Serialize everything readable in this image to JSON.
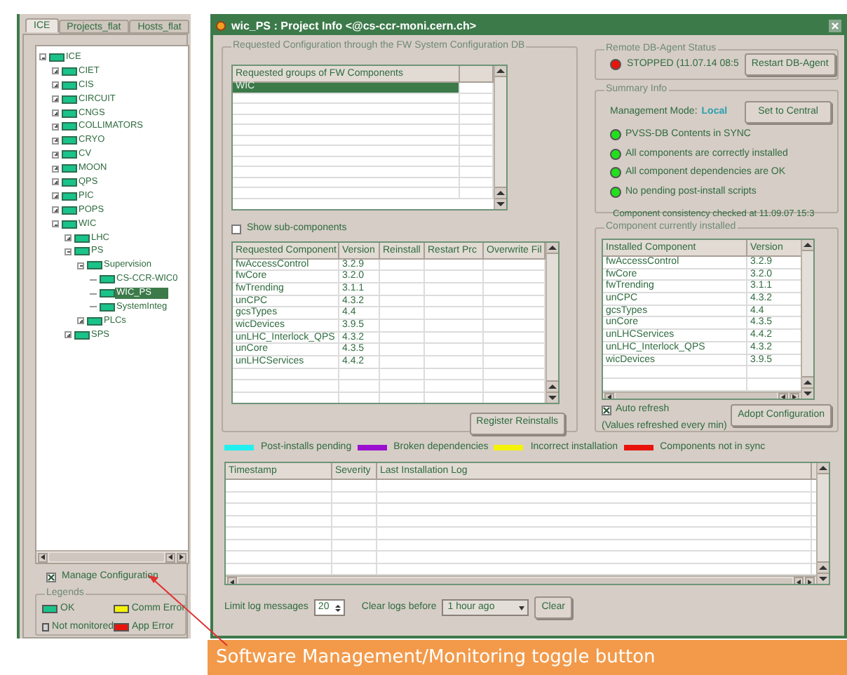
{
  "left_panel": {
    "tabs": [
      {
        "label": "ICE",
        "selected": true
      },
      {
        "label": "Projects_flat",
        "selected": false
      },
      {
        "label": "Hosts_flat",
        "selected": false
      }
    ],
    "tree": [
      {
        "label": "ICE",
        "selected": false,
        "expanded": true,
        "children": [
          {
            "label": "CIET",
            "selected": false,
            "expanded": false
          },
          {
            "label": "CIS",
            "selected": false,
            "expanded": false
          },
          {
            "label": "CIRCUIT",
            "selected": false,
            "expanded": false
          },
          {
            "label": "CNGS",
            "selected": false,
            "expanded": false
          },
          {
            "label": "COLLIMATORS",
            "selected": false,
            "expanded": false
          },
          {
            "label": "CRYO",
            "selected": false,
            "expanded": false
          },
          {
            "label": "CV",
            "selected": false,
            "expanded": false
          },
          {
            "label": "MOON",
            "selected": false,
            "expanded": false
          },
          {
            "label": "QPS",
            "selected": false,
            "expanded": false
          },
          {
            "label": "PIC",
            "selected": false,
            "expanded": false
          },
          {
            "label": "POPS",
            "selected": false,
            "expanded": false
          },
          {
            "label": "WIC",
            "selected": false,
            "expanded": true,
            "children": [
              {
                "label": "LHC",
                "selected": false,
                "expanded": false
              },
              {
                "label": "PS",
                "selected": false,
                "expanded": true,
                "children": [
                  {
                    "label": "Supervision",
                    "selected": false,
                    "expanded": true,
                    "children": [
                      {
                        "label": "CS-CCR-WIC0",
                        "selected": false
                      },
                      {
                        "label": "WIC_PS",
                        "selected": true
                      },
                      {
                        "label": "SystemInteg",
                        "selected": false
                      }
                    ]
                  },
                  {
                    "label": "PLCs",
                    "selected": false,
                    "expanded": false
                  }
                ]
              },
              {
                "label": "SPS",
                "selected": false,
                "expanded": false
              }
            ]
          }
        ]
      }
    ],
    "manage_configuration": {
      "label": "Manage Configuration",
      "checked": true
    },
    "legends": {
      "title": "Legends",
      "items": [
        {
          "label": "OK",
          "color": "#19c38a"
        },
        {
          "label": "Comm Error",
          "color": "#f5f20a"
        },
        {
          "label": "Not monitored",
          "color": "#d0d0d0"
        },
        {
          "label": "App Error",
          "color": "#e8140c"
        }
      ]
    }
  },
  "window": {
    "title": "wic_PS : Project Info <@cs-ccr-moni.cern.ch>",
    "requested_configuration": {
      "title": "Requested Configuration through the FW System Configuration DB",
      "groups_table": {
        "columns": [
          "Requested groups of FW Components"
        ],
        "rows": [
          {
            "cells": [
              "WIC"
            ],
            "selected": true
          }
        ]
      },
      "show_sub_components": {
        "label": "Show sub-components",
        "checked": false
      },
      "components_table": {
        "columns": [
          "Requested Component",
          "Version",
          "Reinstall",
          "Restart Prc",
          "Overwrite Fil"
        ],
        "rows": [
          [
            "fwAccessControl",
            "3.2.9"
          ],
          [
            "fwCore",
            "3.2.0"
          ],
          [
            "fwTrending",
            "3.1.1"
          ],
          [
            "unCPC",
            "4.3.2"
          ],
          [
            "gcsTypes",
            "4.4"
          ],
          [
            "wicDevices",
            "3.9.5"
          ],
          [
            "unLHC_Interlock_QPS",
            "4.3.2"
          ],
          [
            "unCore",
            "4.3.5"
          ],
          [
            "unLHCServices",
            "4.4.2"
          ]
        ]
      },
      "register_button": "Register Reinstalls"
    },
    "db_agent": {
      "title": "Remote DB-Agent Status",
      "status": "STOPPED (11.07.14 08:5",
      "color": "#e8140c",
      "button": "Restart DB-Agent"
    },
    "summary": {
      "title": "Summary Info",
      "mode_label": "Management Mode:",
      "mode_value": "Local",
      "button": "Set to Central",
      "checks": [
        {
          "label": "PVSS-DB Contents in SYNC",
          "color": "#22e01c"
        },
        {
          "label": "All components are correctly installed",
          "color": "#22e01c"
        },
        {
          "label": "All component dependencies are OK",
          "color": "#22e01c"
        },
        {
          "label": "No pending post-install scripts",
          "color": "#22e01c"
        }
      ],
      "consistency": "Component consistency checked at 11.09.07 15:3"
    },
    "installed": {
      "title": "Component currently installed",
      "columns": [
        "Installed Component",
        "Version"
      ],
      "rows": [
        [
          "fwAccessControl",
          "3.2.9"
        ],
        [
          "fwCore",
          "3.2.0"
        ],
        [
          "fwTrending",
          "3.1.1"
        ],
        [
          "unCPC",
          "4.3.2"
        ],
        [
          "gcsTypes",
          "4.4"
        ],
        [
          "unCore",
          "4.3.5"
        ],
        [
          "unLHCServices",
          "4.4.2"
        ],
        [
          "unLHC_Interlock_QPS",
          "4.3.2"
        ],
        [
          "wicDevices",
          "3.9.5"
        ]
      ],
      "auto_refresh": {
        "label": "Auto refresh",
        "checked": true
      },
      "note": "(Values refreshed every min)",
      "button": "Adopt Configuration"
    },
    "status_legend": [
      {
        "label": "Post-installs pending",
        "color": "#22f0f0"
      },
      {
        "label": "Broken dependencies",
        "color": "#9b10d0"
      },
      {
        "label": "Incorrect installation",
        "color": "#f5f20a"
      },
      {
        "label": "Components not in sync",
        "color": "#e8140c"
      }
    ],
    "log_table": {
      "columns": [
        "Timestamp",
        "Severity",
        "Last Installation Log"
      ]
    },
    "controls": {
      "limit_label": "Limit log messages",
      "limit_value": "20",
      "clear_label": "Clear logs before",
      "clear_value": "1 hour ago",
      "clear_button": "Clear"
    }
  },
  "annotation": "Software Management/Monitoring toggle button"
}
